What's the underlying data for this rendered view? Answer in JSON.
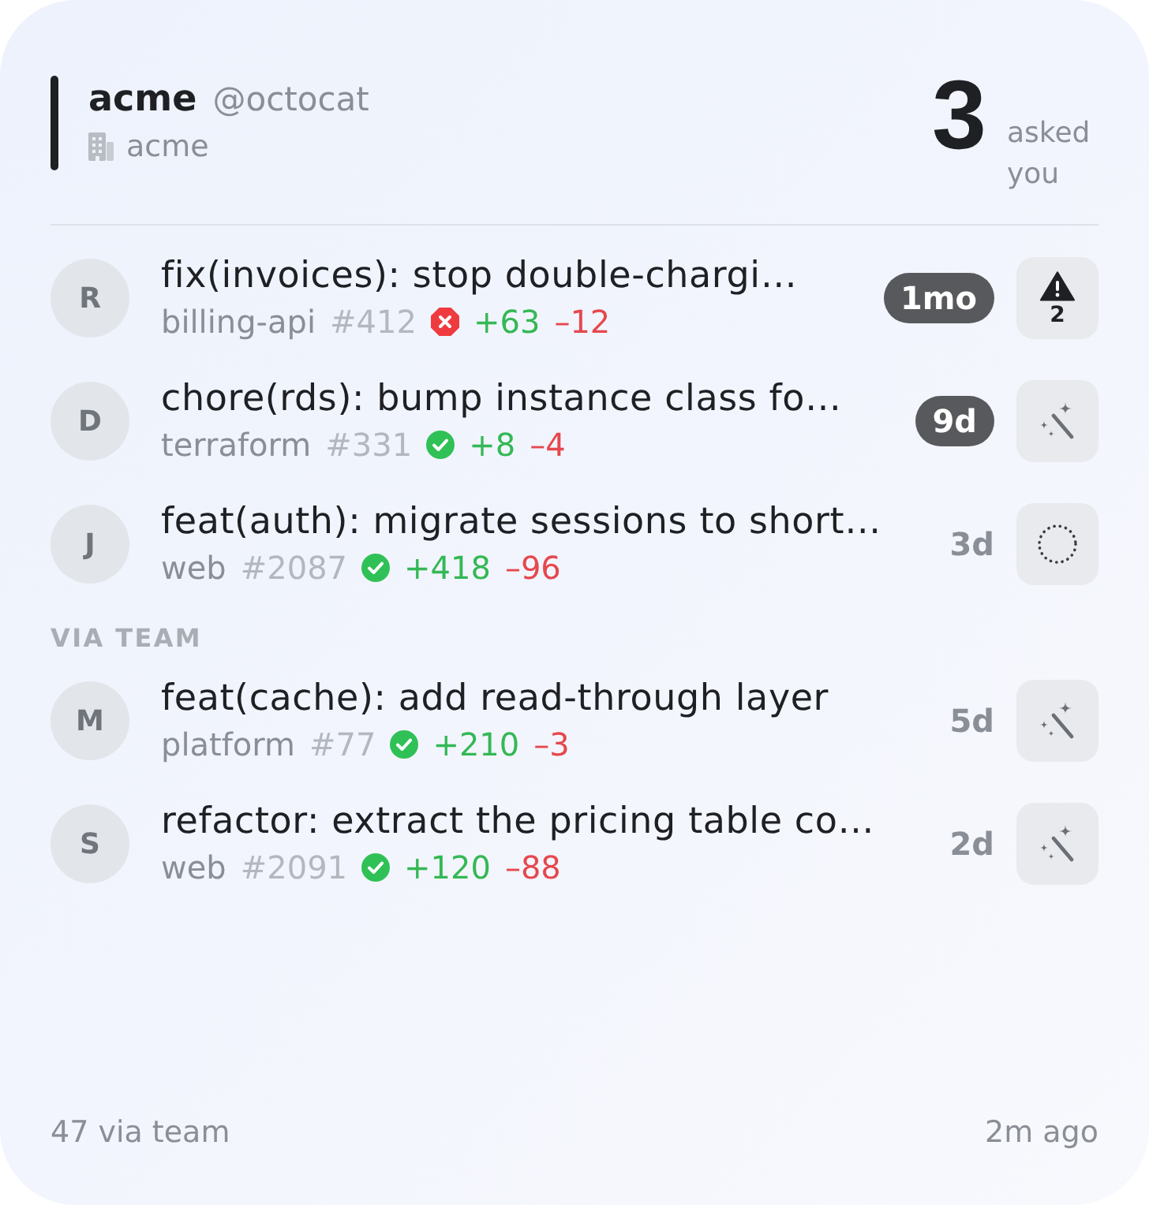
{
  "account": {
    "name": "acme",
    "handle": "@octocat",
    "org": "acme"
  },
  "summary": {
    "count": "3",
    "label": "asked you"
  },
  "requests": [
    {
      "initial": "R",
      "title": "fix(invoices): stop double-chargi…",
      "repo": "billing-api",
      "number": "#412",
      "checks_passed": false,
      "additions": "+63",
      "deletions": "–12",
      "age": "1mo",
      "stale": true,
      "action": {
        "kind": "warning",
        "count": "2"
      }
    },
    {
      "initial": "D",
      "title": "chore(rds): bump instance class fo…",
      "repo": "terraform",
      "number": "#331",
      "checks_passed": true,
      "additions": "+8",
      "deletions": "–4",
      "age": "9d",
      "stale": true,
      "action": {
        "kind": "wand"
      }
    },
    {
      "initial": "J",
      "title": "feat(auth): migrate sessions to short…",
      "repo": "web",
      "number": "#2087",
      "checks_passed": true,
      "additions": "+418",
      "deletions": "–96",
      "age": "3d",
      "stale": false,
      "action": {
        "kind": "pending"
      }
    }
  ],
  "team": {
    "heading": "VIA TEAM",
    "requests": [
      {
        "initial": "M",
        "title": "feat(cache): add read-through layer",
        "repo": "platform",
        "number": "#77",
        "checks_passed": true,
        "additions": "+210",
        "deletions": "–3",
        "age": "5d",
        "stale": false,
        "action": {
          "kind": "wand"
        }
      },
      {
        "initial": "S",
        "title": "refactor: extract the pricing table co…",
        "repo": "web",
        "number": "#2091",
        "checks_passed": true,
        "additions": "+120",
        "deletions": "–88",
        "age": "2d",
        "stale": false,
        "action": {
          "kind": "wand"
        }
      }
    ]
  },
  "footer": {
    "team_total": "47 via team",
    "updated": "2m ago"
  }
}
